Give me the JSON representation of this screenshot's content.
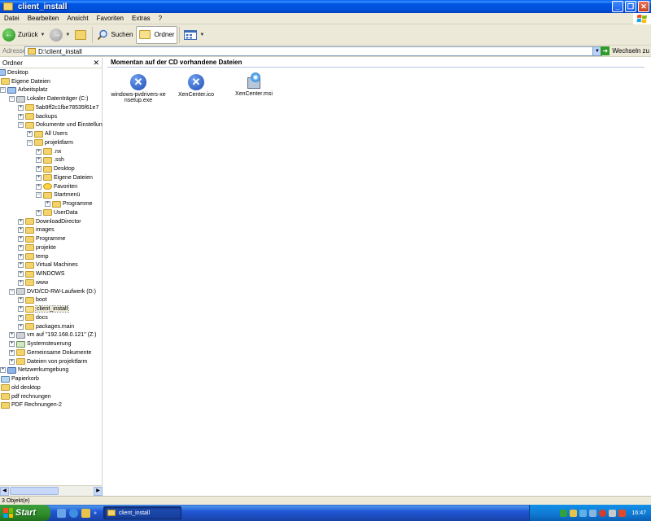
{
  "window": {
    "title": "client_install"
  },
  "menu": {
    "items": [
      "Datei",
      "Bearbeiten",
      "Ansicht",
      "Favoriten",
      "Extras",
      "?"
    ]
  },
  "toolbar": {
    "back_label": "Zurück",
    "search_label": "Suchen",
    "folders_label": "Ordner"
  },
  "address": {
    "label": "Adresse",
    "value": "D:\\client_install",
    "go_label": "Wechseln zu"
  },
  "folders_pane": {
    "title": "Ordner",
    "tree": [
      {
        "label": "Desktop",
        "level": 0,
        "expander": "",
        "icon": "desktop"
      },
      {
        "label": "Eigene Dateien",
        "level": 1,
        "expander": "",
        "icon": "docs"
      },
      {
        "label": "Arbeitsplatz",
        "level": 1,
        "expander": "-",
        "icon": "computer"
      },
      {
        "label": "Lokaler Datenträger (C:)",
        "level": 2,
        "expander": "-",
        "icon": "drive"
      },
      {
        "label": "5ab9ff2c1fbe78535f61e7",
        "level": 3,
        "expander": "+",
        "icon": "folder"
      },
      {
        "label": "backups",
        "level": 3,
        "expander": "+",
        "icon": "folder"
      },
      {
        "label": "Dokumente und Einstellungen",
        "level": 3,
        "expander": "-",
        "icon": "folder"
      },
      {
        "label": "All Users",
        "level": 4,
        "expander": "+",
        "icon": "folder"
      },
      {
        "label": "projektfarm",
        "level": 4,
        "expander": "-",
        "icon": "folder"
      },
      {
        "label": ".nx",
        "level": 5,
        "expander": "+",
        "icon": "folder"
      },
      {
        "label": ".ssh",
        "level": 5,
        "expander": "+",
        "icon": "folder"
      },
      {
        "label": "Desktop",
        "level": 5,
        "expander": "+",
        "icon": "folder"
      },
      {
        "label": "Eigene Dateien",
        "level": 5,
        "expander": "+",
        "icon": "folder"
      },
      {
        "label": "Favoriten",
        "level": 5,
        "expander": "+",
        "icon": "star"
      },
      {
        "label": "Startmenü",
        "level": 5,
        "expander": "-",
        "icon": "folder"
      },
      {
        "label": "Programme",
        "level": 6,
        "expander": "+",
        "icon": "folder"
      },
      {
        "label": "UserData",
        "level": 5,
        "expander": "+",
        "icon": "folder"
      },
      {
        "label": "DownloadDirector",
        "level": 3,
        "expander": "+",
        "icon": "folder"
      },
      {
        "label": "images",
        "level": 3,
        "expander": "+",
        "icon": "folder"
      },
      {
        "label": "Programme",
        "level": 3,
        "expander": "+",
        "icon": "folder"
      },
      {
        "label": "projekte",
        "level": 3,
        "expander": "+",
        "icon": "folder"
      },
      {
        "label": "temp",
        "level": 3,
        "expander": "+",
        "icon": "folder"
      },
      {
        "label": "Virtual Machines",
        "level": 3,
        "expander": "+",
        "icon": "folder"
      },
      {
        "label": "WINDOWS",
        "level": 3,
        "expander": "+",
        "icon": "folder"
      },
      {
        "label": "www",
        "level": 3,
        "expander": "+",
        "icon": "folder"
      },
      {
        "label": "DVD/CD-RW-Laufwerk (D:)",
        "level": 2,
        "expander": "-",
        "icon": "drive"
      },
      {
        "label": "boot",
        "level": 3,
        "expander": "+",
        "icon": "folder"
      },
      {
        "label": "client_install",
        "level": 3,
        "expander": "+",
        "icon": "openfolder",
        "selected": true
      },
      {
        "label": "docs",
        "level": 3,
        "expander": "+",
        "icon": "folder"
      },
      {
        "label": "packages.main",
        "level": 3,
        "expander": "+",
        "icon": "folder"
      },
      {
        "label": "vm auf \"192.168.0.121\" (Z:)",
        "level": 2,
        "expander": "+",
        "icon": "drive"
      },
      {
        "label": "Systemsteuerung",
        "level": 2,
        "expander": "+",
        "icon": "ctrl"
      },
      {
        "label": "Gemeinsame Dokumente",
        "level": 2,
        "expander": "+",
        "icon": "folder"
      },
      {
        "label": "Dateien von projektfarm",
        "level": 2,
        "expander": "+",
        "icon": "folder"
      },
      {
        "label": "Netzwerkumgebung",
        "level": 1,
        "expander": "+",
        "icon": "net"
      },
      {
        "label": "Papierkorb",
        "level": 1,
        "expander": "",
        "icon": "trash"
      },
      {
        "label": "old desktop",
        "level": 1,
        "expander": "",
        "icon": "folder"
      },
      {
        "label": "pdf rechnungen",
        "level": 1,
        "expander": "",
        "icon": "folder"
      },
      {
        "label": "PDF Rechnungen-2",
        "level": 1,
        "expander": "",
        "icon": "folder"
      }
    ]
  },
  "content": {
    "heading": "Momentan auf der CD vorhandene Dateien",
    "files": [
      {
        "name": "windows-pvdrivers-xensetup.exe",
        "line1": "windows-pvdrivers-xe",
        "line2": "nsetup.exe",
        "icon": "xen-x-icon"
      },
      {
        "name": "XenCenter.ico",
        "line1": "XenCenter.ico",
        "line2": "",
        "icon": "xen-x-icon"
      },
      {
        "name": "XenCenter.msi",
        "line1": "XenCenter.msi",
        "line2": "",
        "icon": "installer-icon"
      }
    ]
  },
  "status": {
    "text": "3 Objekt(e)"
  },
  "taskbar": {
    "start_label": "Start",
    "task_label": "client_install",
    "clock": "16:47"
  },
  "colors": {
    "titlebar": "#0054e3",
    "chrome": "#ece9d8",
    "taskbar": "#2157d7",
    "start": "#2e8b2a"
  }
}
